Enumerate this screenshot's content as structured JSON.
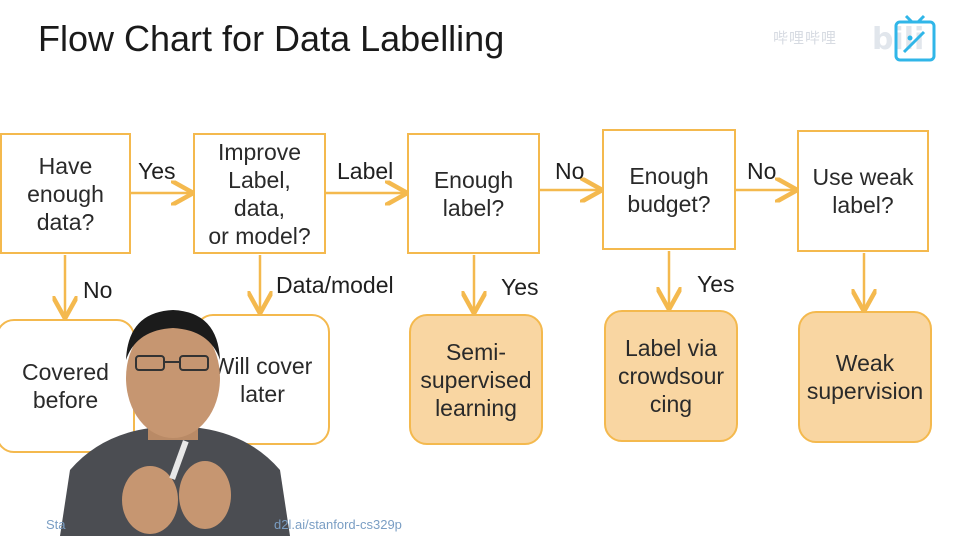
{
  "slide": {
    "title": "Flow Chart for Data Labelling",
    "footer_left": "Sta",
    "footer_url": "d2l.ai/stanford-cs329p"
  },
  "watermark": {
    "text": "哔哩哔哩",
    "brand": "bili",
    "icon": "bilibili-tv-icon"
  },
  "flow": {
    "decisions": [
      {
        "id": "have-data",
        "text": "Have\nenough\ndata?"
      },
      {
        "id": "improve",
        "text": "Improve\nLabel, data,\nor model?"
      },
      {
        "id": "enough-label",
        "text": "Enough\nlabel?"
      },
      {
        "id": "enough-budget",
        "text": "Enough\nbudget?"
      },
      {
        "id": "weak-label",
        "text": "Use weak\nlabel?"
      }
    ],
    "outcomes": [
      {
        "id": "covered",
        "text": "Covered\nbefore"
      },
      {
        "id": "will-cover",
        "text": "Will cover\nlater"
      },
      {
        "id": "semi",
        "text": "Semi-\nsupervised\nlearning"
      },
      {
        "id": "crowd",
        "text": "Label via\ncrowdsour\ncing"
      },
      {
        "id": "weak",
        "text": "Weak\nsupervision"
      }
    ],
    "edge_labels": {
      "have_to_improve": "Yes",
      "improve_to_label": "Label",
      "label_to_budget": "No",
      "budget_to_weak": "No",
      "have_down": "No",
      "improve_down": "Data/model",
      "label_down": "Yes",
      "budget_down": "Yes"
    }
  },
  "colors": {
    "box_border": "#f4b94e",
    "outcome_fill": "#f9d6a2",
    "title": "#1a1a1a"
  }
}
